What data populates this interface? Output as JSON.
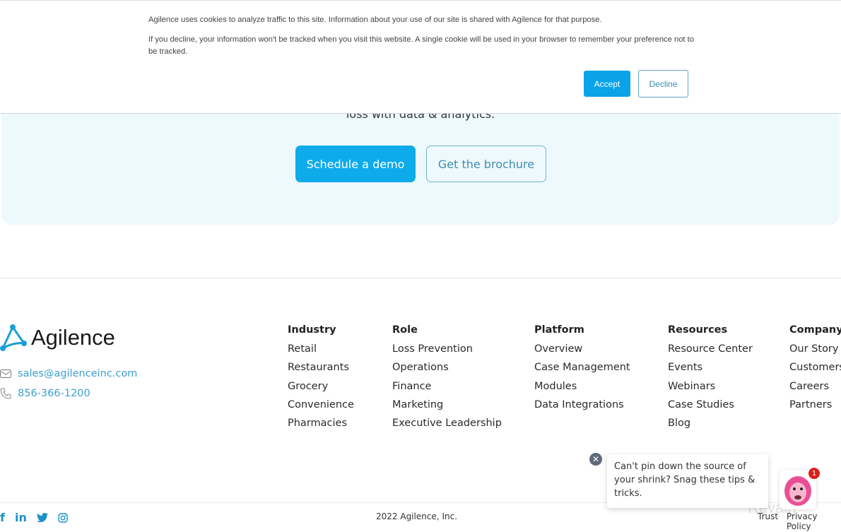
{
  "cookie_banner": {
    "line1": "Agilence uses cookies to analyze traffic to this site. Information about your use of our site is shared with Agilence for that purpose.",
    "line2": "If you decline, your information won't be tracked when you visit this website. A single cookie will be used in your browser to remember your preference not to be tracked.",
    "accept_label": "Accept",
    "decline_label": "Decline"
  },
  "hero": {
    "subtitle_fragment": "loss with data & analytics.",
    "primary_cta": "Schedule a demo",
    "secondary_cta": "Get the brochure"
  },
  "footer": {
    "logo_text": "Agilence",
    "email": "sales@agilenceinc.com",
    "phone": "856-366-1200",
    "columns": [
      {
        "title": "Industry",
        "links": [
          "Retail",
          "Restaurants",
          "Grocery",
          "Convenience",
          "Pharmacies"
        ]
      },
      {
        "title": "Role",
        "links": [
          "Loss Prevention",
          "Operations",
          "Finance",
          "Marketing",
          "Executive Leadership"
        ]
      },
      {
        "title": "Platform",
        "links": [
          "Overview",
          "Case Management",
          "Modules",
          "Data Integrations"
        ]
      },
      {
        "title": "Resources",
        "links": [
          "Resource Center",
          "Events",
          "Webinars",
          "Case Studies",
          "Blog"
        ]
      },
      {
        "title": "Company",
        "links": [
          "Our Story",
          "Customers",
          "Careers",
          "Partners"
        ]
      }
    ],
    "social": [
      "facebook",
      "linkedin",
      "twitter",
      "instagram"
    ],
    "copyright": "2022 Agilence, Inc.",
    "legal_links": [
      "Trust",
      "Privacy Policy"
    ]
  },
  "chat_widget": {
    "message": "Can't pin down the source of your shrink? Snag these tips & tricks.",
    "badge_count": "1"
  },
  "watermark": "Revain",
  "colors": {
    "brand": "#0eabeb",
    "link": "#3b9fce",
    "hero_bg": "#eef9fd"
  }
}
